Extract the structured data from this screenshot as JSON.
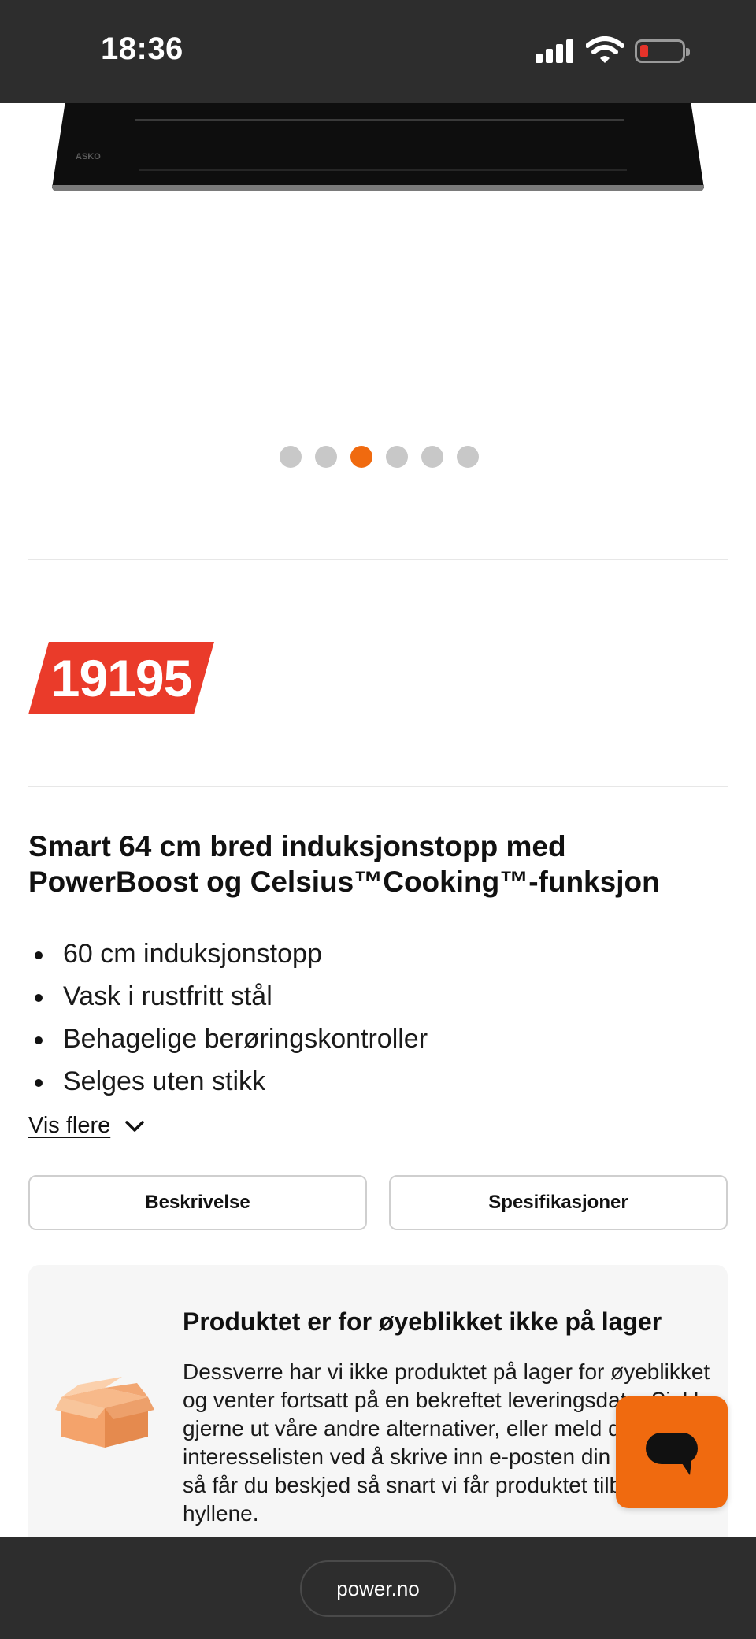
{
  "status_bar": {
    "time": "18:36",
    "icons": [
      "cellular-signal-icon",
      "wifi-icon",
      "battery-low-icon"
    ],
    "battery_color": "#e5332a"
  },
  "product_image": {
    "brand_mark": "ASKO"
  },
  "carousel": {
    "slide_count": 6,
    "active_index": 2,
    "active_color": "#f06a0f"
  },
  "price": {
    "amount": "19195",
    "tag_color": "#ea3b2a"
  },
  "product": {
    "title": "Smart 64 cm bred induksjonstopp med PowerBoost og Celsius™Cooking™-funksjon",
    "features": [
      "60 cm induksjonstopp",
      "Vask i rustfritt stål",
      "Behagelige berøringskontroller",
      "Selges uten stikk"
    ],
    "show_more_label": "Vis flere"
  },
  "tabs": {
    "description_label": "Beskrivelse",
    "specifications_label": "Spesifikasjoner"
  },
  "stock_notice": {
    "title": "Produktet er for øyeblikket ikke på lager",
    "text": "Dessverre har vi ikke produktet på lager for øyeblikket og venter fortsatt på en bekreftet leveringsdato. Sjekk gjerne ut våre andre alternativer, eller meld deg på interesselisten ved å skrive inn e-posten din nedenfor, så får du beskjed så snart vi får produktet tilbake i hyllene.",
    "icon": "box-icon"
  },
  "chat": {
    "icon": "chat-icon",
    "color": "#f06a0f"
  },
  "browser": {
    "url": "power.no"
  }
}
